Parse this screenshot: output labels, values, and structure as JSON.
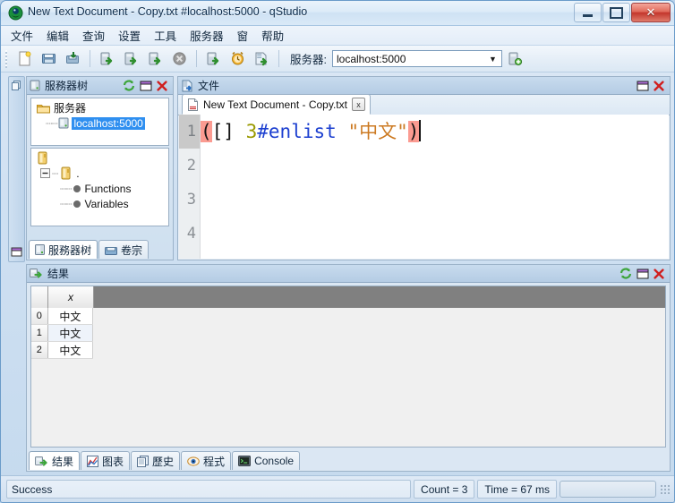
{
  "window": {
    "title": "New Text Document - Copy.txt #localhost:5000 - qStudio",
    "app_icon": "qstudio-icon",
    "buttons": {
      "minimize": "minimize-button",
      "maximize": "maximize-button",
      "close": "close-button"
    }
  },
  "menubar": {
    "items": [
      {
        "label": "文件"
      },
      {
        "label": "编辑"
      },
      {
        "label": "查询"
      },
      {
        "label": "设置"
      },
      {
        "label": "工具"
      },
      {
        "label": "服务器"
      },
      {
        "label": "窗"
      },
      {
        "label": "帮助"
      }
    ]
  },
  "toolbar": {
    "buttons": [
      {
        "name": "new-file-icon"
      },
      {
        "name": "open-file-icon"
      },
      {
        "name": "save-file-icon"
      },
      {
        "name": "run-query-icon"
      },
      {
        "name": "run-line-icon"
      },
      {
        "name": "run-selection-icon"
      },
      {
        "name": "stop-query-icon"
      },
      {
        "name": "run-server-icon"
      },
      {
        "name": "refresh-server-icon"
      },
      {
        "name": "export-icon"
      }
    ],
    "server_label": "服务器:",
    "server_value": "localhost:5000",
    "add_server_icon": "add-server-icon"
  },
  "tree_panel": {
    "title": "服務器树",
    "icons": [
      "refresh-icon",
      "restore-icon",
      "close-icon"
    ],
    "servers": {
      "root": "服务器",
      "child": "localhost:5000"
    },
    "objects": {
      "namespace": ".",
      "items": [
        "Functions",
        "Variables"
      ]
    },
    "tabs": [
      {
        "label": "服務器树",
        "icon": "server-tree-icon",
        "active": true
      },
      {
        "label": "卷宗",
        "icon": "folder-icon",
        "active": false
      }
    ]
  },
  "doc_panel": {
    "title": "文件",
    "icons": [
      "restore-icon",
      "close-icon"
    ],
    "tabs": [
      {
        "label": "New Text Document - Copy.txt",
        "close": "x",
        "active": true
      }
    ],
    "line_numbers": [
      "1",
      "2",
      "3",
      "4"
    ],
    "current_line": 1,
    "code": {
      "open_paren": "(",
      "brackets": "[]",
      "space1": " ",
      "number": "3",
      "func": "#enlist",
      "space2": " ",
      "string": "\"中文\"",
      "close_paren": ")"
    }
  },
  "results_panel": {
    "title": "结果",
    "icons": [
      "refresh-icon",
      "restore-icon",
      "close-icon"
    ],
    "grid": {
      "columns": [
        "x"
      ],
      "row_indices": [
        "0",
        "1",
        "2"
      ],
      "rows": [
        [
          "中文"
        ],
        [
          "中文"
        ],
        [
          "中文"
        ]
      ]
    },
    "tabs": [
      {
        "label": "结果",
        "icon": "results-icon",
        "active": true
      },
      {
        "label": "图表",
        "icon": "chart-icon",
        "active": false
      },
      {
        "label": "歷史",
        "icon": "history-icon",
        "active": false
      },
      {
        "label": "程式",
        "icon": "program-icon",
        "active": false
      },
      {
        "label": "Console",
        "icon": "console-icon",
        "active": false
      }
    ]
  },
  "statusbar": {
    "message": "Success",
    "count": "Count = 3",
    "time": "Time = 67 ms"
  },
  "colors": {
    "accent": "#2f8ff0",
    "paren_match": "#fb9b91",
    "string": "#cc7a22",
    "function": "#1c3fd0",
    "number": "#9a9a00"
  }
}
